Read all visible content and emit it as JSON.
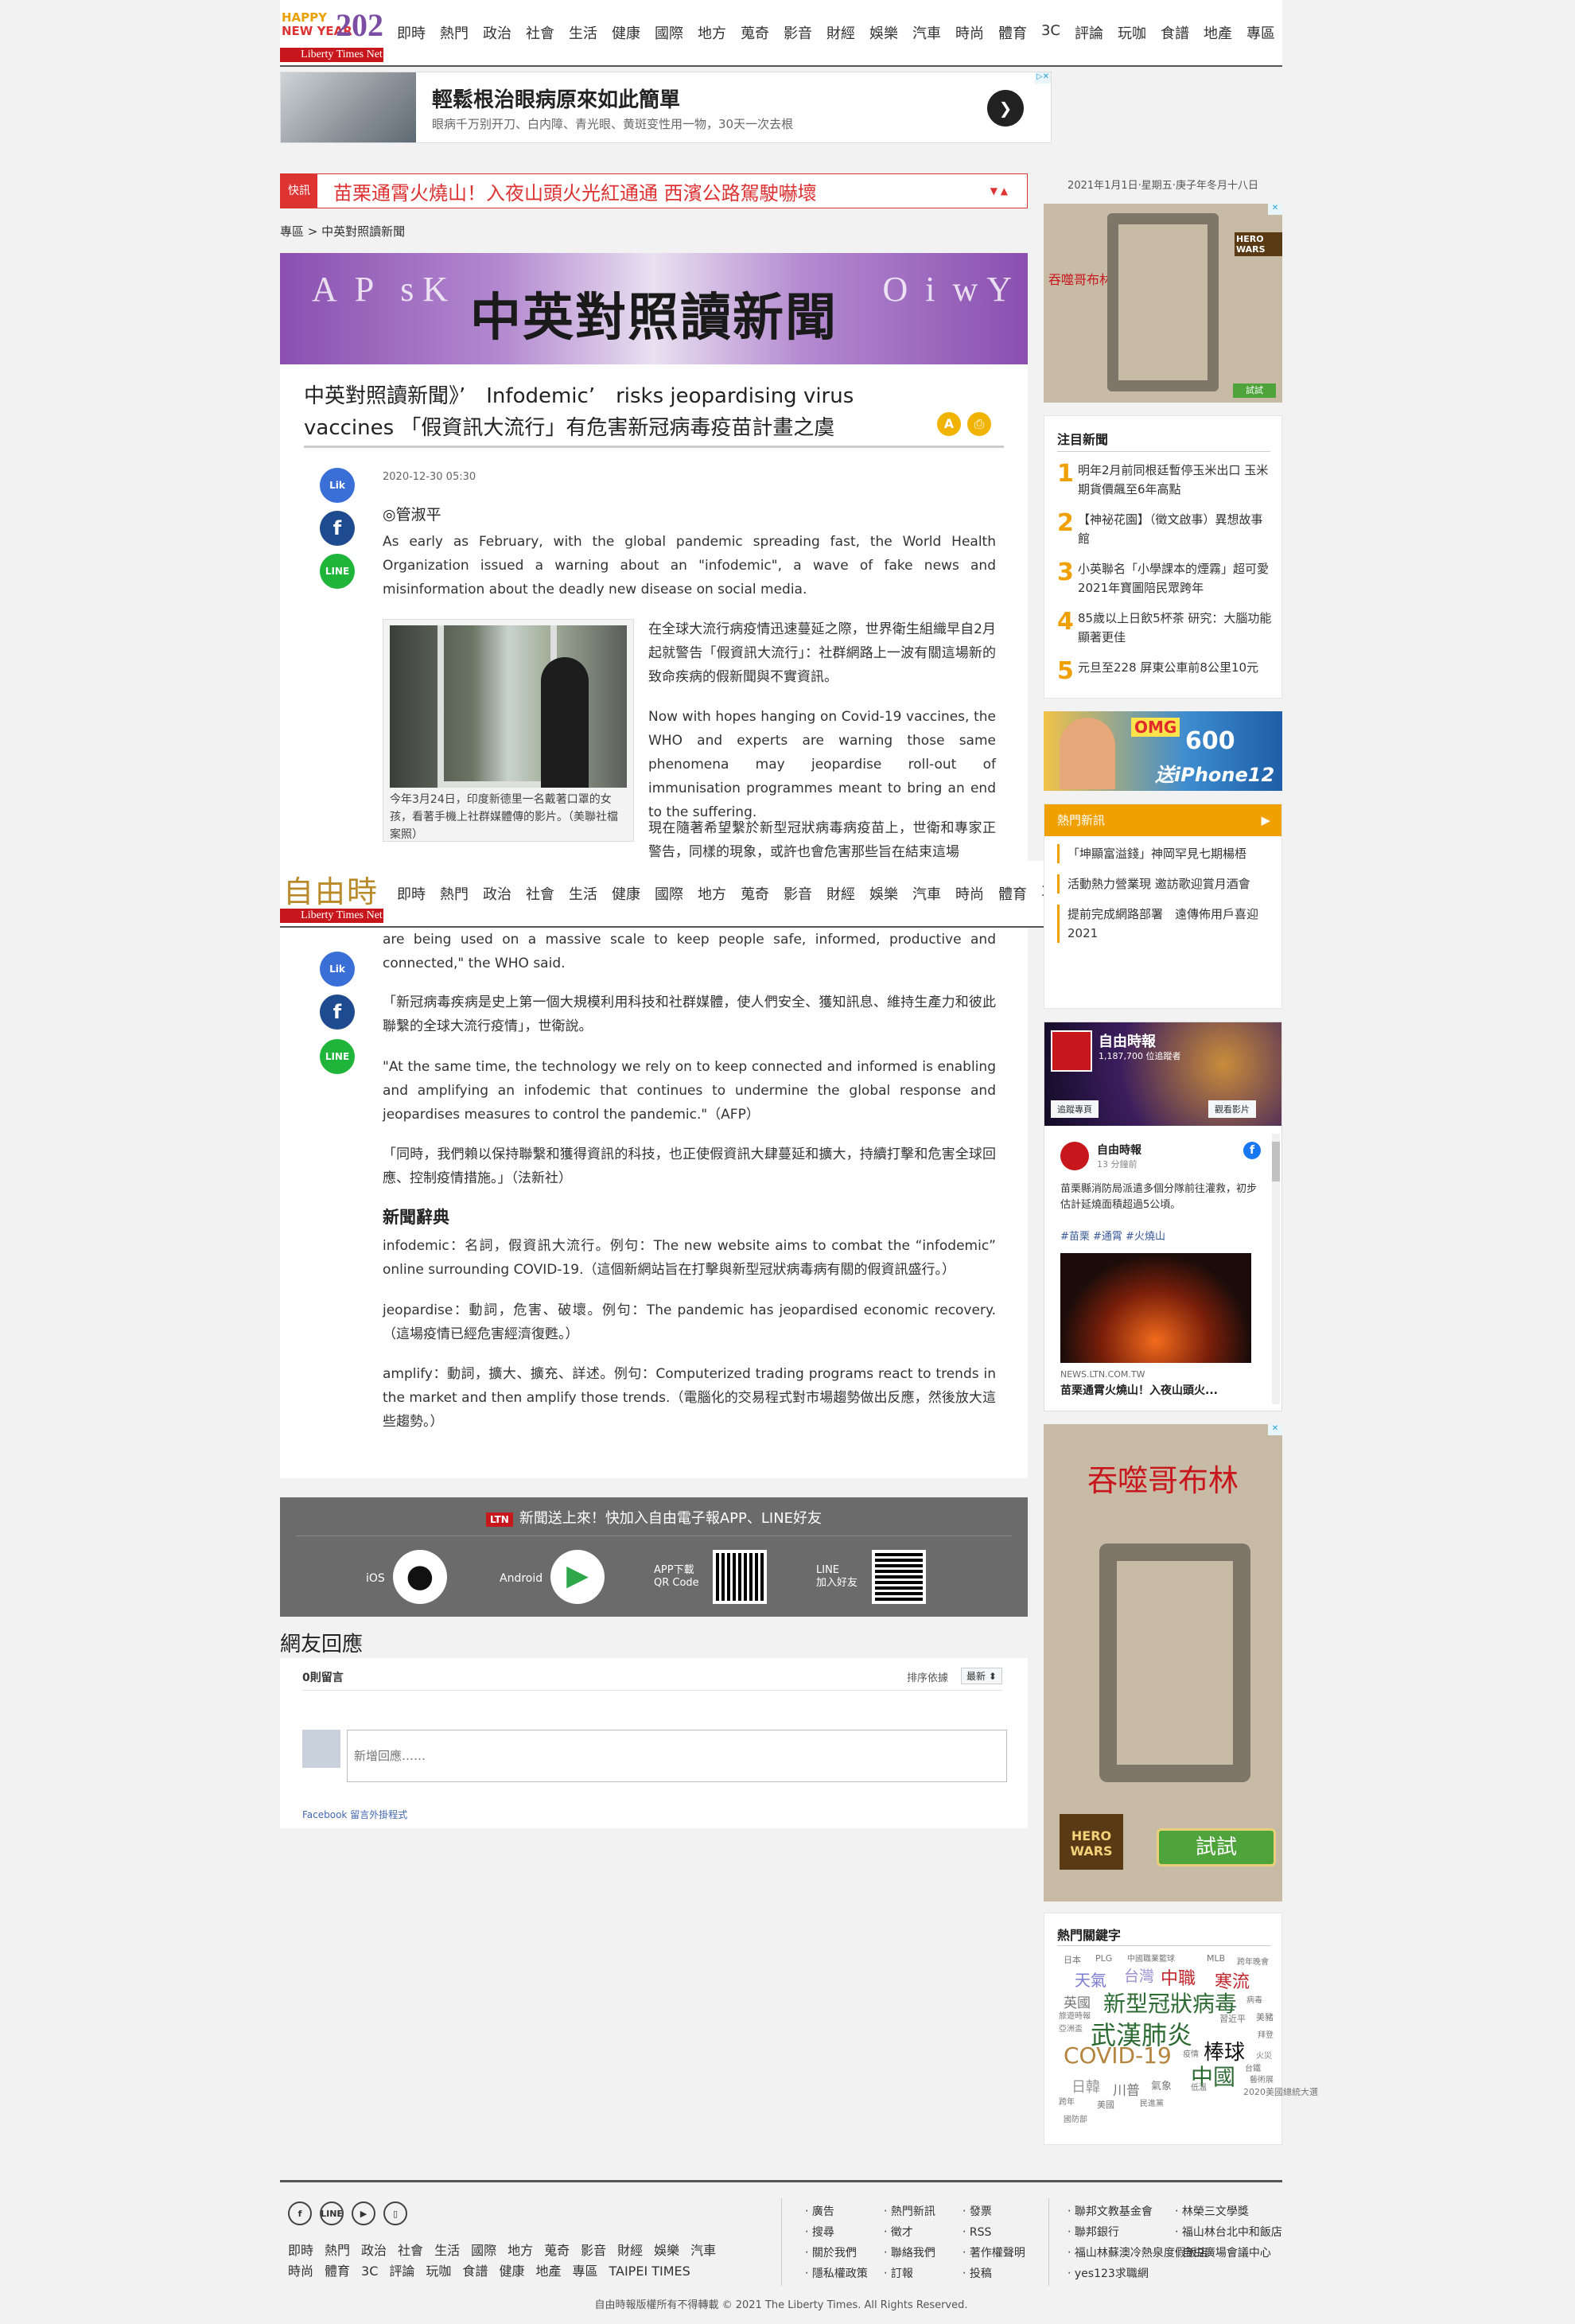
{
  "header": {
    "logo_happy": "HAPPY",
    "logo_newyear": "NEW YEAR",
    "logo_year": "2021",
    "logo_brand": "Liberty Times Net",
    "logo_brand_cn": "自由時報",
    "nav": [
      "即時",
      "熱門",
      "政治",
      "社會",
      "生活",
      "健康",
      "國際",
      "地方",
      "蒐奇",
      "影音",
      "財經",
      "娛樂",
      "汽車",
      "時尚",
      "體育",
      "3C",
      "評論",
      "玩咖",
      "食譜",
      "地產",
      "專區"
    ],
    "accent": "#c8161d"
  },
  "ad_top": {
    "title": "輕鬆根治眼病原來如此簡單",
    "subtitle": "眼病千万别开刀、白内障、青光眼、黄斑变性用一物，30天一次去根",
    "arrow": "❯"
  },
  "ticker": {
    "tag": "快訊",
    "text": "苗栗通霄火燒山！入夜山頭火光紅通通 西濱公路駕駛嚇壞",
    "ctl": "▼ ▲"
  },
  "breadcrumb": "專區 > 中英對照讀新聞",
  "banner": {
    "title": "中英對照讀新聞"
  },
  "article": {
    "title": "中英對照讀新聞》’　Infodemic’　risks jeopardising virus vaccines 「假資訊大流行」有危害新冠病毒疫苗計畫之虞",
    "date": "2020-12-30 05:30",
    "author": "◎管淑平",
    "p1": "As early as February, with the global pandemic spreading fast, the World Health Organization issued a warning about an \"infodemic\", a wave of fake news and misinformation about the deadly new disease on social media.",
    "p2": "在全球大流行病疫情迅速蔓延之際，世界衛生組織早自2月起就警告「假資訊大流行」：社群網路上一波有關這場新的致命疾病的假新聞與不實資訊。",
    "p3": "Now with hopes hanging on Covid-19 vaccines, the WHO and experts are warning those same phenomena may jeopardise roll-out of immunisation programmes meant to bring an end to the suffering.",
    "p4": "現在隨著希望繫於新型冠狀病毒病疫苗上，世衛和專家正警告，同樣的現象，或許也會危害那些旨在結束這場",
    "caption": "今年3月24日，印度新德里一名戴著口罩的女孩，看著手機上社群媒體傳的影片。（美聯社檔案照）",
    "p5": "are being used on a massive scale to keep people safe, informed, productive and connected,\" the WHO said.",
    "p6": "「新冠病毒疾病是史上第一個大規模利用科技和社群媒體，使人們安全、獲知訊息、維持生產力和彼此聯繫的全球大流行疫情」，世衛說。",
    "p7": "\"At the same time, the technology we rely on to keep connected and informed is enabling and amplifying an infodemic that continues to undermine the global response and jeopardises measures to control the pandemic.\"（AFP）",
    "p8": "「同時，我們賴以保持聯繫和獲得資訊的科技，也正使假資訊大肆蔓延和擴大，持續打擊和危害全球回應、控制疫情措施。」（法新社）",
    "glossary_title": "新聞辭典",
    "g1": "infodemic：名詞，假資訊大流行。例句：The new website aims to combat the “infodemic” online surrounding COVID-19.（這個新網站旨在打擊與新型冠狀病毒病有關的假資訊盛行。）",
    "g2": "jeopardise：動詞，危害、破壞。例句：The pandemic has jeopardised economic recovery.（這場疫情已經危害經濟復甦。）",
    "g3": "amplify：動詞，擴大、擴充、詳述。例句：Computerized trading programs react to trends in the market and then amplify those trends.（電腦化的交易程式對市場趨勢做出反應，然後放大這些趨勢。）",
    "like_label": "Lik",
    "line_label": "LINE",
    "fb_label": "f"
  },
  "app_bar": {
    "ltn": "LTN",
    "title": "新聞送上來！快加入自由電子報APP、LINE好友",
    "ios": "iOS",
    "android": "Android",
    "qr_label": "APP下載\nQR Code",
    "line_label": "LINE\n加入好友"
  },
  "comments": {
    "heading": "網友回應",
    "count": "0則留言",
    "sort_label": "排序依據",
    "sort_value": "最新 ⬍",
    "placeholder": "新增回應……",
    "plugin": "Facebook 留言外掛程式"
  },
  "sidebar": {
    "date": "2021年1月1日‧星期五‧庚子年冬月十八日",
    "ad_game_label": "吞噬哥布林",
    "ad_game_btn": "試試",
    "ad_game_brand": "HERO WARS",
    "hot_title": "注目新聞",
    "hot": [
      {
        "n": "1",
        "t": "明年2月前同根廷暫停玉米出口 玉米期貨價飆至6年高點"
      },
      {
        "n": "2",
        "t": "【神祕花園】（徵文啟事）異想故事館"
      },
      {
        "n": "3",
        "t": "小英聯名「小學課本的煙霧」超可愛2021年寶圖陪民眾跨年"
      },
      {
        "n": "4",
        "t": "85歲以上日飲5杯茶 研究：大腦功能顯著更佳"
      },
      {
        "n": "5",
        "t": "元旦至228 屏東公車前8公里10元"
      }
    ],
    "iphone_ad": "送iPhone12",
    "iphone_omg": "OMG",
    "iphone_600": "600",
    "hot_news_title": "熱門新訊",
    "hot_news": [
      "「坤顯富溢錢」神岡罕見七期楊梧",
      "活動熱力營業現 邀訪歌迎賞月酒會",
      "提前完成網路部署　遠傳佈用戶喜迎2021"
    ],
    "fb_page": "自由時報",
    "fb_likes": "1,187,700 位追蹤者",
    "fb_follow": "追蹤專頁",
    "fb_share": "觀看影片",
    "fb_post_name": "自由時報",
    "fb_post_time": "13 分鐘前",
    "fb_post_text": "苗栗縣消防局派遣多個分隊前往灌救，初步估計延燒面積超過5公頃。",
    "fb_post_tags": "#苗栗 #通霄 #火燒山",
    "fb_post_domain": "NEWS.LTN.COM.TW",
    "fb_post_title": "苗栗通霄火燒山！入夜山頭火...",
    "ad2_title": "吞噬哥布林",
    "ad2_btn": "試試",
    "ad2_brand": "HERO WARS",
    "keywords_title": "熱門關鍵字",
    "keywords": [
      "日本",
      "PLG",
      "中國職業籃球",
      "MLB",
      "跨年晚會",
      "天氣",
      "台灣",
      "中職",
      "寒流",
      "英國",
      "新型冠狀病毒",
      "病毒",
      "旅遊時報",
      "亞洲盃",
      "習近平",
      "美豬",
      "武漢肺炎",
      "拜登",
      "COVID-19",
      "疫情",
      "棒球",
      "火災",
      "中國",
      "台鐵",
      "日韓",
      "川普",
      "氣象",
      "低溫",
      "藝術展",
      "跨年",
      "美國",
      "民進黨",
      "2020美國總統大選",
      "國防部"
    ]
  },
  "footer": {
    "social": [
      "f",
      "LINE",
      "▶",
      "▯"
    ],
    "links1": [
      "即時",
      "熱門",
      "政治",
      "社會",
      "生活",
      "國際",
      "地方",
      "蒐奇",
      "影音",
      "財經",
      "娛樂",
      "汽車"
    ],
    "links2": [
      "時尚",
      "體育",
      "3C",
      "評論",
      "玩咖",
      "食譜",
      "健康",
      "地產",
      "專區",
      "TAIPEI TIMES"
    ],
    "col2": [
      "‧ 廣告",
      "‧ 熱門新訊",
      "‧ 發票",
      "‧ 搜尋",
      "‧ 徵才",
      "‧ RSS",
      "‧ 關於我們",
      "‧ 聯絡我們",
      "‧ 著作權聲明",
      "‧ 隱私權政策",
      "‧ 訂報",
      "‧ 投稿"
    ],
    "col3": [
      "‧ 聯邦文教基金會",
      "‧ 林榮三文學獎",
      "‧ 聯邦銀行",
      "‧ 福山林台北中和飯店",
      "‧ 福山林蘇澳冷熱泉度假飯店",
      "‧ 自由廣場會議中心",
      "‧ yes123求職網"
    ],
    "copyright": "自由時報版權所有不得轉載  © 2021 The Liberty Times. All Rights Reserved."
  }
}
